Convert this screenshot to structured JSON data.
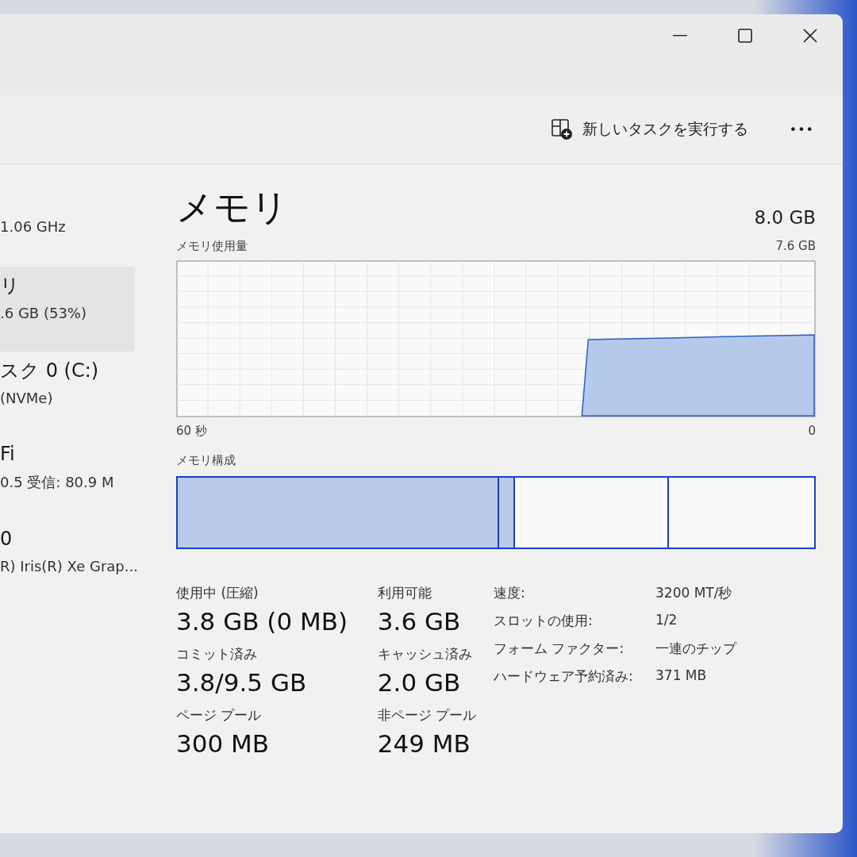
{
  "toolbar": {
    "run_task": "新しいタスクを実行する",
    "more": "•••"
  },
  "sidebar": {
    "items": [
      {
        "detail": "1.06 GHz",
        "selected": false
      },
      {
        "title": "リ",
        "detail": ".6 GB (53%)",
        "selected": true
      },
      {
        "title": "スク 0 (C:)",
        "detail": "(NVMe)",
        "selected": false
      },
      {
        "title": "Fi",
        "detail": "0.5  受信: 80.9 M",
        "selected": false
      },
      {
        "title": "0",
        "detail": "R) Iris(R) Xe Grap...",
        "selected": false
      }
    ]
  },
  "main": {
    "title": "メモリ",
    "total": "8.0 GB",
    "usage_graph": {
      "label": "メモリ使用量",
      "max": "7.6 GB",
      "left_axis": "60 秒",
      "right_axis": "0"
    },
    "composition": {
      "label": "メモリ構成"
    },
    "stats": [
      {
        "label": "使用中 (圧縮)",
        "value": "3.8 GB (0 MB)"
      },
      {
        "label": "利用可能",
        "value": "3.6 GB"
      },
      {
        "label": "コミット済み",
        "value": "3.8/9.5 GB"
      },
      {
        "label": "キャッシュ済み",
        "value": "2.0 GB"
      },
      {
        "label": "ページ プール",
        "value": "300 MB"
      },
      {
        "label": "非ページ プール",
        "value": "249 MB"
      }
    ],
    "properties": [
      {
        "label": "速度:",
        "value": "3200 MT/秒"
      },
      {
        "label": "スロットの使用:",
        "value": "1/2"
      },
      {
        "label": "フォーム ファクター:",
        "value": "一連のチップ"
      },
      {
        "label": "ハードウェア予約済み:",
        "value": "371 MB"
      }
    ]
  }
}
